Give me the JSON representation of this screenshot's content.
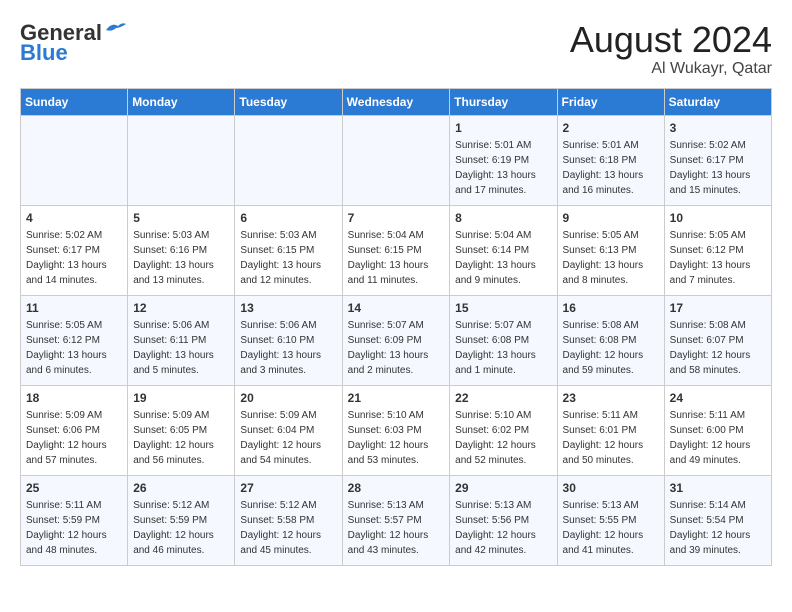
{
  "logo": {
    "general": "General",
    "blue": "Blue"
  },
  "header": {
    "month": "August 2024",
    "location": "Al Wukayr, Qatar"
  },
  "weekdays": [
    "Sunday",
    "Monday",
    "Tuesday",
    "Wednesday",
    "Thursday",
    "Friday",
    "Saturday"
  ],
  "weeks": [
    [
      {
        "day": "",
        "info": ""
      },
      {
        "day": "",
        "info": ""
      },
      {
        "day": "",
        "info": ""
      },
      {
        "day": "",
        "info": ""
      },
      {
        "day": "1",
        "info": "Sunrise: 5:01 AM\nSunset: 6:19 PM\nDaylight: 13 hours\nand 17 minutes."
      },
      {
        "day": "2",
        "info": "Sunrise: 5:01 AM\nSunset: 6:18 PM\nDaylight: 13 hours\nand 16 minutes."
      },
      {
        "day": "3",
        "info": "Sunrise: 5:02 AM\nSunset: 6:17 PM\nDaylight: 13 hours\nand 15 minutes."
      }
    ],
    [
      {
        "day": "4",
        "info": "Sunrise: 5:02 AM\nSunset: 6:17 PM\nDaylight: 13 hours\nand 14 minutes."
      },
      {
        "day": "5",
        "info": "Sunrise: 5:03 AM\nSunset: 6:16 PM\nDaylight: 13 hours\nand 13 minutes."
      },
      {
        "day": "6",
        "info": "Sunrise: 5:03 AM\nSunset: 6:15 PM\nDaylight: 13 hours\nand 12 minutes."
      },
      {
        "day": "7",
        "info": "Sunrise: 5:04 AM\nSunset: 6:15 PM\nDaylight: 13 hours\nand 11 minutes."
      },
      {
        "day": "8",
        "info": "Sunrise: 5:04 AM\nSunset: 6:14 PM\nDaylight: 13 hours\nand 9 minutes."
      },
      {
        "day": "9",
        "info": "Sunrise: 5:05 AM\nSunset: 6:13 PM\nDaylight: 13 hours\nand 8 minutes."
      },
      {
        "day": "10",
        "info": "Sunrise: 5:05 AM\nSunset: 6:12 PM\nDaylight: 13 hours\nand 7 minutes."
      }
    ],
    [
      {
        "day": "11",
        "info": "Sunrise: 5:05 AM\nSunset: 6:12 PM\nDaylight: 13 hours\nand 6 minutes."
      },
      {
        "day": "12",
        "info": "Sunrise: 5:06 AM\nSunset: 6:11 PM\nDaylight: 13 hours\nand 5 minutes."
      },
      {
        "day": "13",
        "info": "Sunrise: 5:06 AM\nSunset: 6:10 PM\nDaylight: 13 hours\nand 3 minutes."
      },
      {
        "day": "14",
        "info": "Sunrise: 5:07 AM\nSunset: 6:09 PM\nDaylight: 13 hours\nand 2 minutes."
      },
      {
        "day": "15",
        "info": "Sunrise: 5:07 AM\nSunset: 6:08 PM\nDaylight: 13 hours\nand 1 minute."
      },
      {
        "day": "16",
        "info": "Sunrise: 5:08 AM\nSunset: 6:08 PM\nDaylight: 12 hours\nand 59 minutes."
      },
      {
        "day": "17",
        "info": "Sunrise: 5:08 AM\nSunset: 6:07 PM\nDaylight: 12 hours\nand 58 minutes."
      }
    ],
    [
      {
        "day": "18",
        "info": "Sunrise: 5:09 AM\nSunset: 6:06 PM\nDaylight: 12 hours\nand 57 minutes."
      },
      {
        "day": "19",
        "info": "Sunrise: 5:09 AM\nSunset: 6:05 PM\nDaylight: 12 hours\nand 56 minutes."
      },
      {
        "day": "20",
        "info": "Sunrise: 5:09 AM\nSunset: 6:04 PM\nDaylight: 12 hours\nand 54 minutes."
      },
      {
        "day": "21",
        "info": "Sunrise: 5:10 AM\nSunset: 6:03 PM\nDaylight: 12 hours\nand 53 minutes."
      },
      {
        "day": "22",
        "info": "Sunrise: 5:10 AM\nSunset: 6:02 PM\nDaylight: 12 hours\nand 52 minutes."
      },
      {
        "day": "23",
        "info": "Sunrise: 5:11 AM\nSunset: 6:01 PM\nDaylight: 12 hours\nand 50 minutes."
      },
      {
        "day": "24",
        "info": "Sunrise: 5:11 AM\nSunset: 6:00 PM\nDaylight: 12 hours\nand 49 minutes."
      }
    ],
    [
      {
        "day": "25",
        "info": "Sunrise: 5:11 AM\nSunset: 5:59 PM\nDaylight: 12 hours\nand 48 minutes."
      },
      {
        "day": "26",
        "info": "Sunrise: 5:12 AM\nSunset: 5:59 PM\nDaylight: 12 hours\nand 46 minutes."
      },
      {
        "day": "27",
        "info": "Sunrise: 5:12 AM\nSunset: 5:58 PM\nDaylight: 12 hours\nand 45 minutes."
      },
      {
        "day": "28",
        "info": "Sunrise: 5:13 AM\nSunset: 5:57 PM\nDaylight: 12 hours\nand 43 minutes."
      },
      {
        "day": "29",
        "info": "Sunrise: 5:13 AM\nSunset: 5:56 PM\nDaylight: 12 hours\nand 42 minutes."
      },
      {
        "day": "30",
        "info": "Sunrise: 5:13 AM\nSunset: 5:55 PM\nDaylight: 12 hours\nand 41 minutes."
      },
      {
        "day": "31",
        "info": "Sunrise: 5:14 AM\nSunset: 5:54 PM\nDaylight: 12 hours\nand 39 minutes."
      }
    ]
  ]
}
